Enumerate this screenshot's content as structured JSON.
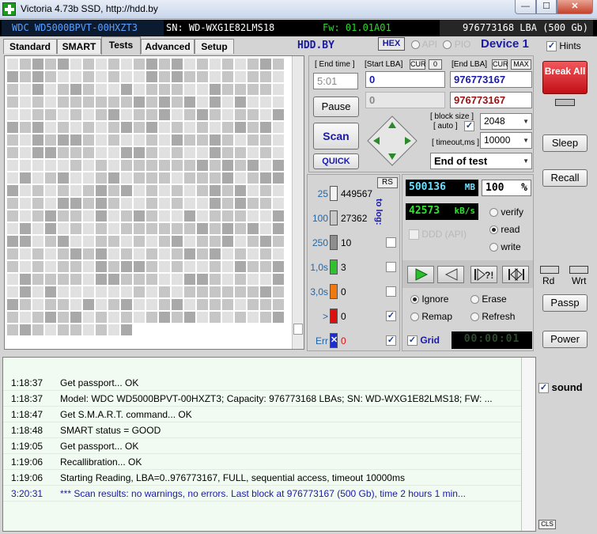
{
  "window": {
    "title": "Victoria 4.73b SSD, http://hdd.by",
    "minimize": "—",
    "maximize": "☐",
    "close": "✕"
  },
  "drive": {
    "model": "WDC WD5000BPVT-00HXZT3",
    "serial": "SN: WD-WXG1E82LMS18",
    "firmware": "Fw: 01.01A01",
    "capacity": "976773168 LBA (500 Gb)"
  },
  "tabs": [
    "Standard",
    "SMART",
    "Tests",
    "Advanced",
    "Setup"
  ],
  "toolbar": {
    "brand": "HDD.BY",
    "hex": "HEX",
    "api": "API",
    "pio": "PIO",
    "device": "Device 1",
    "hints": "Hints"
  },
  "test": {
    "end_time_label": "[ End time ]",
    "end_time_value": "5:01",
    "start_lba_label": "[Start LBA]",
    "cur_label": "CUR",
    "zero_label": "0",
    "end_lba_label": "[End LBA]",
    "max_label": "MAX",
    "start_lba": "0",
    "end_lba": "976773167",
    "current_start": "0",
    "current_end": "976773167",
    "pause": "Pause",
    "scan": "Scan",
    "quick": "QUICK",
    "block_size_label": "[ block size ]",
    "auto_label": "[ auto ]",
    "block_size": "2048",
    "timeout_label": "[ timeout,ms ]",
    "timeout": "10000",
    "end_action": "End of test"
  },
  "stats": {
    "rs": "RS",
    "to_log": "to log:",
    "rows": [
      {
        "label": "25",
        "count": "449567",
        "color": "#f3f3f3"
      },
      {
        "label": "100",
        "count": "27362",
        "color": "#c8c8c8"
      },
      {
        "label": "250",
        "count": "10",
        "color": "#8e8e8e"
      },
      {
        "label": "1,0s",
        "count": "3",
        "color": "#30c030"
      },
      {
        "label": "3,0s",
        "count": "0",
        "color": "#f07a10"
      },
      {
        "label": ">",
        "count": "0",
        "color": "#dd1010"
      },
      {
        "label": "Err",
        "count": "0",
        "color": "#1a2fd0"
      }
    ],
    "err_mark": "✕"
  },
  "monitor": {
    "mb_value": "500136",
    "mb_unit": "MB",
    "percent_value": "100",
    "percent_unit": "%",
    "speed_value": "42573",
    "speed_unit": "kB/s",
    "ddd_api": "DDD (API)",
    "verify": "verify",
    "read": "read",
    "write": "write",
    "ignore": "Ignore",
    "erase": "Erase",
    "remap": "Remap",
    "refresh": "Refresh",
    "grid": "Grid",
    "timer": "00:00:01"
  },
  "side": {
    "break_all": "Break All",
    "sleep": "Sleep",
    "recall": "Recall",
    "rd": "Rd",
    "wrt": "Wrt",
    "passp": "Passp",
    "power": "Power",
    "sound": "sound",
    "cls": "CLS"
  },
  "log": [
    {
      "time": "1:18:37",
      "text": "Get passport... OK",
      "blue": false
    },
    {
      "time": "1:18:37",
      "text": "Model: WDC WD5000BPVT-00HXZT3; Capacity: 976773168 LBAs; SN: WD-WXG1E82LMS18; FW: ...",
      "blue": false
    },
    {
      "time": "1:18:47",
      "text": "Get S.M.A.R.T. command... OK",
      "blue": false
    },
    {
      "time": "1:18:48",
      "text": "SMART status = GOOD",
      "blue": false
    },
    {
      "time": "1:19:05",
      "text": "Get passport... OK",
      "blue": false
    },
    {
      "time": "1:19:06",
      "text": "Recallibration... OK",
      "blue": false
    },
    {
      "time": "1:19:06",
      "text": "Starting Reading, LBA=0..976773167, FULL, sequential access, timeout 10000ms",
      "blue": false
    },
    {
      "time": "3:20:31",
      "text": "*** Scan results: no warnings, no errors. Last block at 976773167 (500 Gb), time 2 hours 1 min...",
      "blue": true
    }
  ],
  "colors": {
    "accent_blue": "#1a1aa8",
    "break_red": "#d8141c",
    "log_bg": "#f1fbf1"
  }
}
